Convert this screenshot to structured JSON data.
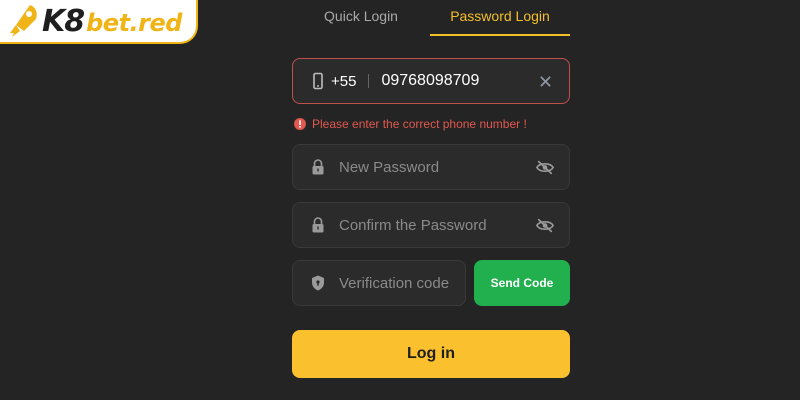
{
  "logo": {
    "part1": "K8",
    "part2": "bet.red",
    "icon": "rocket-icon"
  },
  "tabs": [
    {
      "label": "Quick Login",
      "active": false
    },
    {
      "label": "Password Login",
      "active": true
    }
  ],
  "phone": {
    "icon": "phone-icon",
    "country_code": "+55",
    "value": "09768098709",
    "clear_icon": "close-icon",
    "error": "Please enter the correct phone number !"
  },
  "new_password": {
    "placeholder": "New Password",
    "icon": "lock-icon",
    "toggle_icon": "eye-off-icon"
  },
  "confirm_password": {
    "placeholder": "Confirm the Password",
    "icon": "lock-icon",
    "toggle_icon": "eye-off-icon"
  },
  "verification": {
    "placeholder": "Verification code",
    "icon": "shield-icon"
  },
  "send_code_label": "Send Code",
  "login_label": "Log in",
  "colors": {
    "background": "#242424",
    "accent": "#fbc02d",
    "tab_active": "#f5bf2b",
    "error": "#e0584f",
    "send_button": "#22b04f"
  }
}
